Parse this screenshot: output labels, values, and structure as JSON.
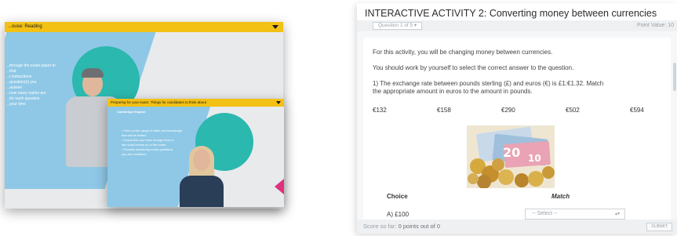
{
  "video_back": {
    "header_title": "...ouse: Reading",
    "bullets": [
      "...through the exam paper to",
      "...that",
      "...t instructions",
      "...question(s) you",
      "...answer",
      "...how many marks are",
      "...for each question",
      "...your time"
    ]
  },
  "video_front": {
    "header_title": "Preparing for your exam: Things for candidates to think about",
    "logo_text": "Cambridge English",
    "bullets": [
      "• Find out the range of skills and knowledge",
      "  that will be tested.",
      "• Check that you have enough time to",
      "  see what comes up in the exam.",
      "• Practise answering exam questions",
      "  you are confident."
    ]
  },
  "activity": {
    "title": "INTERACTIVE ACTIVITY 2: Converting money between currencies",
    "question_selector": "Question 1 of 5",
    "point_value": "Point Value: 10",
    "intro_1": "For this activity, you will be changing money between currencies.",
    "intro_2": "You should work by yourself to select the correct answer to the question.",
    "question_line_1": "1) The exchange rate between pounds sterling (£) and euros (€) is £1:€1.32. Match",
    "question_line_2": "the appropriate amount in euros to the amount in pounds.",
    "amounts": [
      "€132",
      "€158",
      "€290",
      "€502",
      "€594"
    ],
    "choice_header": "Choice",
    "match_header": "Match",
    "choice_a": "A) £100",
    "select_placeholder": "-- Select --",
    "score_label": "Score so far:",
    "score_value": "0 points out of 0",
    "submit_label": "SUBMIT"
  },
  "colors": {
    "header_yellow": "#f3c014",
    "light_blue": "#8ec8e6",
    "teal": "#2bb8ae",
    "pink": "#e0317e"
  }
}
